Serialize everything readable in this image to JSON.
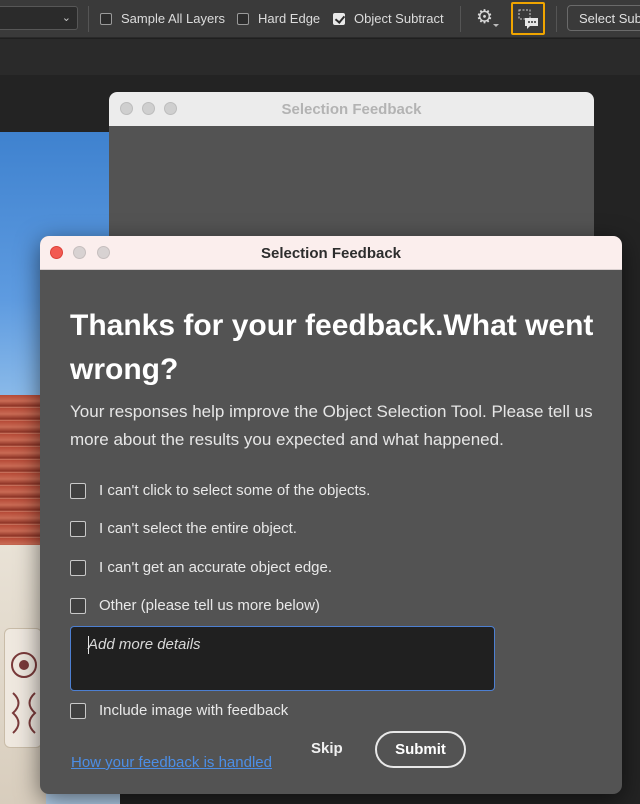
{
  "options_bar": {
    "sample_all_layers": {
      "label": "Sample All Layers",
      "checked": false
    },
    "hard_edge": {
      "label": "Hard Edge",
      "checked": false
    },
    "object_subtract": {
      "label": "Object Subtract",
      "checked": true
    },
    "select_subject_label": "Select Subject",
    "accent_color": "#f0a500"
  },
  "back_window": {
    "title": "Selection Feedback"
  },
  "dialog": {
    "title": "Selection Feedback",
    "heading": "Thanks for your feedback.What went wrong?",
    "description": "Your responses help improve the Object Selection Tool. Please tell us more about the results you expected and what happened.",
    "options": [
      {
        "label": "I can't click to select some of the objects.",
        "checked": false
      },
      {
        "label": "I can't select the entire object.",
        "checked": false
      },
      {
        "label": "I can't get an accurate object edge.",
        "checked": false
      },
      {
        "label": "Other (please tell us more below)",
        "checked": false
      }
    ],
    "details_placeholder": "Add more details",
    "include_image": {
      "label": "Include image with feedback",
      "checked": false
    },
    "link_text": "How your feedback is handled",
    "skip_label": "Skip",
    "submit_label": "Submit",
    "link_color": "#4c8ee6",
    "close_color": "#f25a52"
  }
}
